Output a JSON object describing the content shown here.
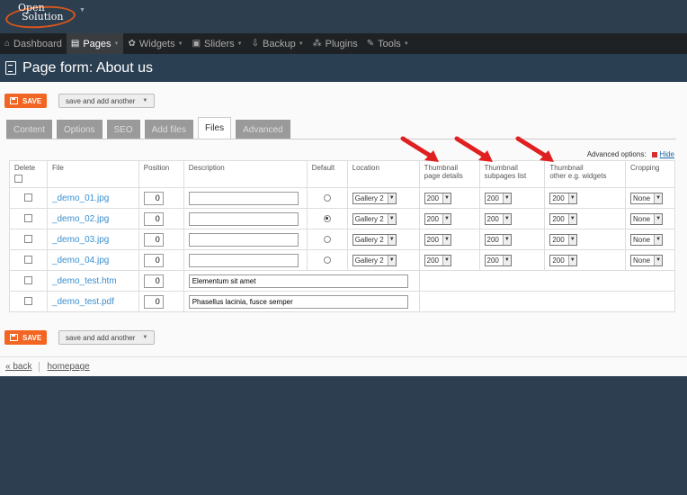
{
  "brand": {
    "logo_text_top": "Open",
    "logo_text_bottom": "Solution",
    "accent": "#f26522"
  },
  "menu": [
    {
      "label": "Dashboard",
      "icon": "home-icon",
      "caret": false,
      "active": false
    },
    {
      "label": "Pages",
      "icon": "document-icon",
      "caret": true,
      "active": true
    },
    {
      "label": "Widgets",
      "icon": "widgets-icon",
      "caret": true,
      "active": false
    },
    {
      "label": "Sliders",
      "icon": "image-icon",
      "caret": true,
      "active": false
    },
    {
      "label": "Backup",
      "icon": "backup-icon",
      "caret": true,
      "active": false
    },
    {
      "label": "Plugins",
      "icon": "plugins-icon",
      "caret": false,
      "active": false
    },
    {
      "label": "Tools",
      "icon": "tools-icon",
      "caret": true,
      "active": false
    }
  ],
  "page": {
    "title": "Page form: About us"
  },
  "buttons": {
    "save": "SAVE",
    "save_add_another": "save and add another"
  },
  "tabs": [
    {
      "label": "Content",
      "active": false
    },
    {
      "label": "Options",
      "active": false
    },
    {
      "label": "SEO",
      "active": false
    },
    {
      "label": "Add files",
      "active": false
    },
    {
      "label": "Files",
      "active": true
    },
    {
      "label": "Advanced",
      "active": false
    }
  ],
  "advanced_options": {
    "label": "Advanced options:",
    "hide": "Hide"
  },
  "table": {
    "headers": {
      "delete": "Delete",
      "file": "File",
      "position": "Position",
      "description": "Description",
      "default": "Default",
      "location": "Location",
      "thumb1_l1": "Thumbnail",
      "thumb1_l2": "page details",
      "thumb2_l1": "Thumbnail",
      "thumb2_l2": "subpages list",
      "thumb3_l1": "Thumbnail",
      "thumb3_l2": "other e.g. widgets",
      "cropping": "Cropping"
    },
    "rows": [
      {
        "file": "_demo_01.jpg",
        "position": "0",
        "description": "",
        "default": false,
        "location": "Gallery 2",
        "thumb1": "200",
        "thumb2": "200",
        "thumb3": "200",
        "cropping": "None"
      },
      {
        "file": "_demo_02.jpg",
        "position": "0",
        "description": "",
        "default": true,
        "location": "Gallery 2",
        "thumb1": "200",
        "thumb2": "200",
        "thumb3": "200",
        "cropping": "None"
      },
      {
        "file": "_demo_03.jpg",
        "position": "0",
        "description": "",
        "default": false,
        "location": "Gallery 2",
        "thumb1": "200",
        "thumb2": "200",
        "thumb3": "200",
        "cropping": "None"
      },
      {
        "file": "_demo_04.jpg",
        "position": "0",
        "description": "",
        "default": false,
        "location": "Gallery 2",
        "thumb1": "200",
        "thumb2": "200",
        "thumb3": "200",
        "cropping": "None"
      },
      {
        "file": "_demo_test.htm",
        "position": "0",
        "description": "Elementum sit amet"
      },
      {
        "file": "_demo_test.pdf",
        "position": "0",
        "description": "Phasellus lacinia, fusce semper"
      }
    ]
  },
  "footer": {
    "back": "« back",
    "homepage": "homepage"
  }
}
